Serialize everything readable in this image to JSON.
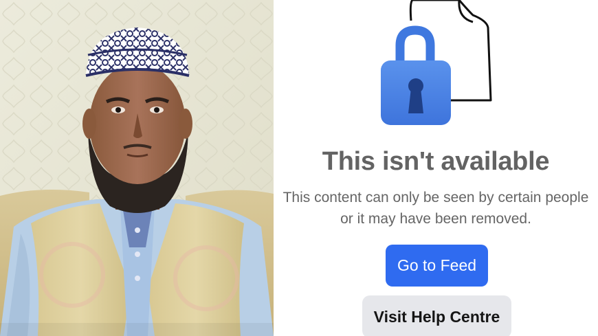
{
  "left_panel": {
    "photo_icon": "portrait-photo"
  },
  "error_panel": {
    "icon": "lock-icon",
    "icon_secondary": "document-icon",
    "title": "This isn't available",
    "message_line_1": "This content can only be seen by certain people",
    "message_line_2": "or it may have been removed.",
    "primary_button_label": "Go to Feed",
    "secondary_button_label": "Visit Help Centre",
    "colors": {
      "primary_button": "#2f6bf0",
      "secondary_button": "#e6e7eb",
      "lock_body": "#4f86e6",
      "title_text": "#636363"
    }
  }
}
